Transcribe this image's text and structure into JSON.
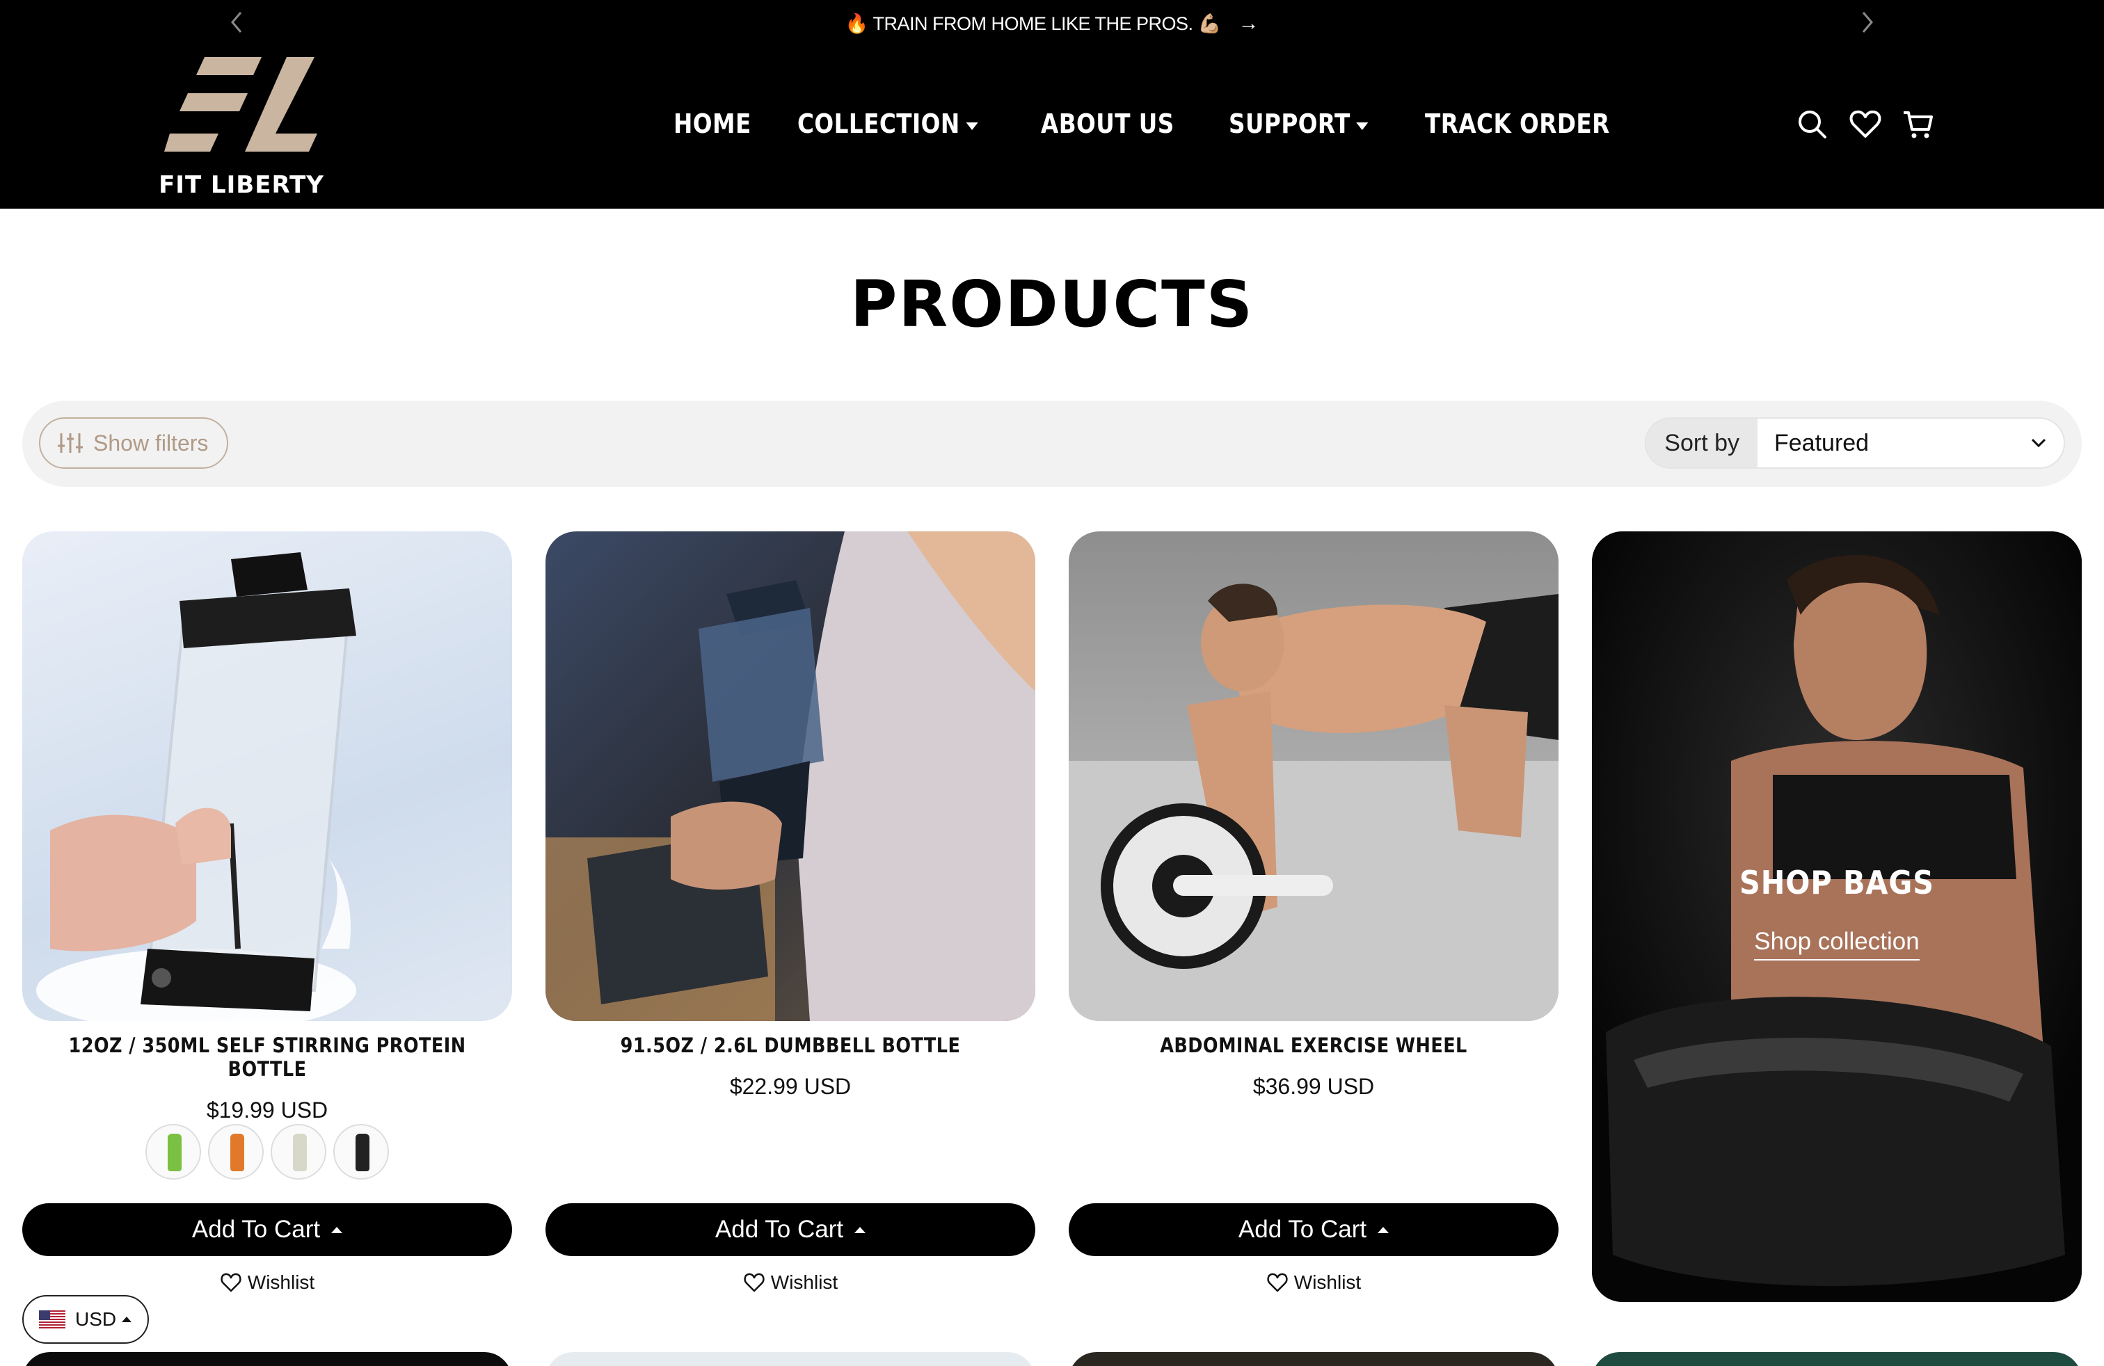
{
  "announcement": {
    "text": "🔥 TRAIN FROM HOME LIKE THE PROS. 💪🏼",
    "prev_icon": "chevron-left-icon",
    "next_icon": "chevron-right-icon"
  },
  "brand": {
    "name": "FIT LIBERTY",
    "accent": "#c9b5a0"
  },
  "nav": {
    "items": [
      {
        "label": "HOME",
        "dropdown": false
      },
      {
        "label": "COLLECTION",
        "dropdown": true
      },
      {
        "label": "ABOUT US",
        "dropdown": false
      },
      {
        "label": "SUPPORT",
        "dropdown": true
      },
      {
        "label": "TRACK ORDER",
        "dropdown": false
      }
    ]
  },
  "header_icons": [
    "search-icon",
    "heart-icon",
    "cart-icon"
  ],
  "page": {
    "title": "PRODUCTS"
  },
  "filters": {
    "show_label": "Show filters",
    "sort_label": "Sort by",
    "sort_value": "Featured"
  },
  "products": [
    {
      "title": "12OZ / 350ML SELF STIRRING PROTEIN BOTTLE",
      "price": "$19.99 USD",
      "add_label": "Add To Cart",
      "wishlist_label": "Wishlist",
      "swatch_colors": [
        "#7ac043",
        "#e07a2a",
        "#d8d8c8",
        "#222222"
      ]
    },
    {
      "title": "91.5OZ / 2.6L DUMBBELL BOTTLE",
      "price": "$22.99 USD",
      "add_label": "Add To Cart",
      "wishlist_label": "Wishlist"
    },
    {
      "title": "ABDOMINAL EXERCISE WHEEL",
      "price": "$36.99 USD",
      "add_label": "Add To Cart",
      "wishlist_label": "Wishlist"
    }
  ],
  "promo": {
    "title": "SHOP BAGS",
    "link": "Shop collection"
  },
  "currency": {
    "code": "USD",
    "flag_icon": "us-flag-icon"
  }
}
